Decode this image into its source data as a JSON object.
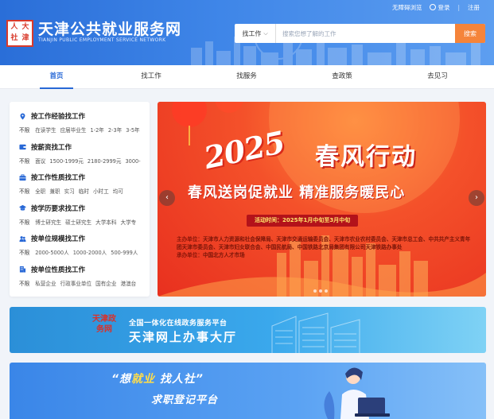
{
  "header": {
    "logo_chars": [
      "人",
      "大",
      "社",
      "津"
    ],
    "title": "天津公共就业服务网",
    "subtitle": "TIANJIN PUBLIC EMPLOYMENT SERVICE NETWORK",
    "accessibility": "无障碍浏览",
    "login": "登录",
    "separator": "|",
    "register": "注册"
  },
  "search": {
    "category": "找工作",
    "placeholder": "搜索您想了解的工作",
    "button": "搜索"
  },
  "nav": {
    "items": [
      {
        "label": "首页",
        "active": true
      },
      {
        "label": "找工作",
        "active": false
      },
      {
        "label": "找服务",
        "active": false
      },
      {
        "label": "查政策",
        "active": false
      },
      {
        "label": "去见习",
        "active": false
      }
    ]
  },
  "categories": [
    {
      "title": "按工作经验找工作",
      "icon": "location-pin-icon",
      "label": "不限",
      "options": [
        "在读学生",
        "应届毕业生",
        "1-2年",
        "2-3年",
        "3-5年"
      ]
    },
    {
      "title": "按薪资找工作",
      "icon": "wallet-icon",
      "label": "不限",
      "options": [
        "面议",
        "1500-1999元",
        "2180-2999元",
        "3000-"
      ]
    },
    {
      "title": "按工作性质找工作",
      "icon": "briefcase-icon",
      "label": "不限",
      "options": [
        "全职",
        "兼职",
        "实习",
        "临时",
        "小时工",
        "均可"
      ]
    },
    {
      "title": "按学历要求找工作",
      "icon": "graduation-cap-icon",
      "label": "不限",
      "options": [
        "博士研究生",
        "硕士研究生",
        "大学本科",
        "大学专"
      ]
    },
    {
      "title": "按单位规模找工作",
      "icon": "people-icon",
      "label": "不限",
      "options": [
        "2000-5000人",
        "1000-2000人",
        "500-999人"
      ]
    },
    {
      "title": "按单位性质找工作",
      "icon": "building-icon",
      "label": "不限",
      "options": [
        "私营企业",
        "行政事业单位",
        "国有企业",
        "港澳台"
      ]
    }
  ],
  "banner": {
    "year": "2025",
    "title": "春风行动",
    "slogan": "春风送岗促就业 精准服务暖民心",
    "time": "活动时间：2025年1月中旬至3月中旬",
    "organizers_label": "主办单位：",
    "organizers": "天津市人力资源和社会保障局、天津市交通运输委员会、天津市农业农村委员会、天津市总工会、中共共产主义青年团天津市委员会、天津市妇女联合会、中国民航局、中国铁路北京局集团有限公司天津铁路办事处",
    "undertaker_label": "承办单位：",
    "undertaker": "中国北方人才市场",
    "colors": {
      "primary": "#f4512a",
      "accent": "#ffe36a"
    }
  },
  "service_banner": {
    "seal_chars": [
      "天",
      "津",
      "政",
      "务",
      "网"
    ],
    "subtitle": "全国一体化在线政务服务平台",
    "title": "天津网上办事大厅"
  },
  "job_banner": {
    "line1_prefix": "“想",
    "line1_highlight": "就业",
    "line1_suffix": " 找人社”",
    "line2": "求职登记平台"
  },
  "colors": {
    "brand_blue": "#2868d6",
    "search_button": "#f5843a",
    "seal_red": "#d93a2b"
  }
}
